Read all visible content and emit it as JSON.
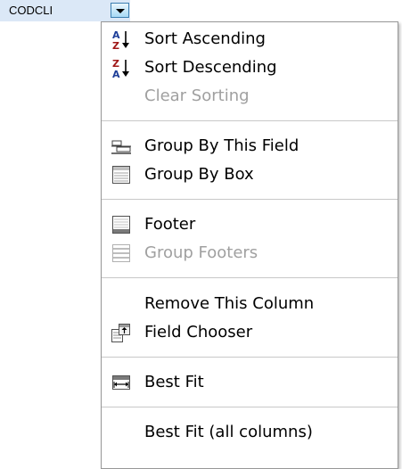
{
  "column_header": {
    "label": "CODCLI"
  },
  "menu": {
    "items": [
      {
        "label": "Sort Ascending",
        "icon": "sort-ascending-icon",
        "enabled": true
      },
      {
        "label": "Sort Descending",
        "icon": "sort-descending-icon",
        "enabled": true
      },
      {
        "label": "Clear Sorting",
        "icon": "",
        "enabled": false
      },
      {
        "label": "Group By This Field",
        "icon": "group-by-field-icon",
        "enabled": true
      },
      {
        "label": "Group By Box",
        "icon": "group-by-box-icon",
        "enabled": true
      },
      {
        "label": "Footer",
        "icon": "footer-icon",
        "enabled": true
      },
      {
        "label": "Group Footers",
        "icon": "group-footers-icon",
        "enabled": false
      },
      {
        "label": "Remove This Column",
        "icon": "",
        "enabled": true
      },
      {
        "label": "Field Chooser",
        "icon": "field-chooser-icon",
        "enabled": true
      },
      {
        "label": "Best Fit",
        "icon": "best-fit-icon",
        "enabled": true
      },
      {
        "label": "Best Fit (all columns)",
        "icon": "",
        "enabled": true
      }
    ]
  },
  "colors": {
    "header_bg": "#dbe8f7",
    "menu_border": "#979797",
    "disabled_text": "#a0a0a0",
    "sort_icon_letters": "#1f3f99"
  }
}
